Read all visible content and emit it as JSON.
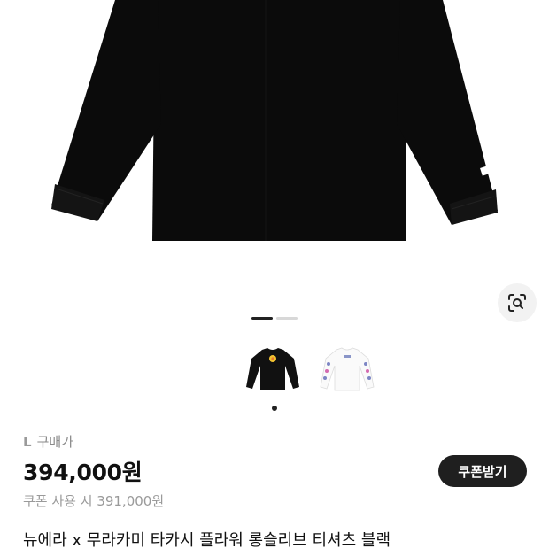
{
  "product": {
    "size_label": "L",
    "purchase_label": "구매가",
    "price": "394,000원",
    "coupon_price_text": "쿠폰 사용 시 391,000원",
    "title": "뉴에라 x 무라카미 타카시 플라워 롱슬리브 티셔츠 블랙"
  },
  "actions": {
    "coupon_button": "쿠폰받기"
  },
  "gallery": {
    "image_count": 2,
    "active_index": 0,
    "thumbnails": [
      {
        "name": "black-shirt-thumbnail",
        "color": "#111111"
      },
      {
        "name": "white-shirt-thumbnail",
        "color": "#ffffff"
      }
    ]
  },
  "colors": {
    "shirt": "#0b0b0b",
    "button_bg": "#1f1f1f",
    "muted_text": "#9a9a9a"
  },
  "icons": {
    "lens": "image-search-icon"
  }
}
